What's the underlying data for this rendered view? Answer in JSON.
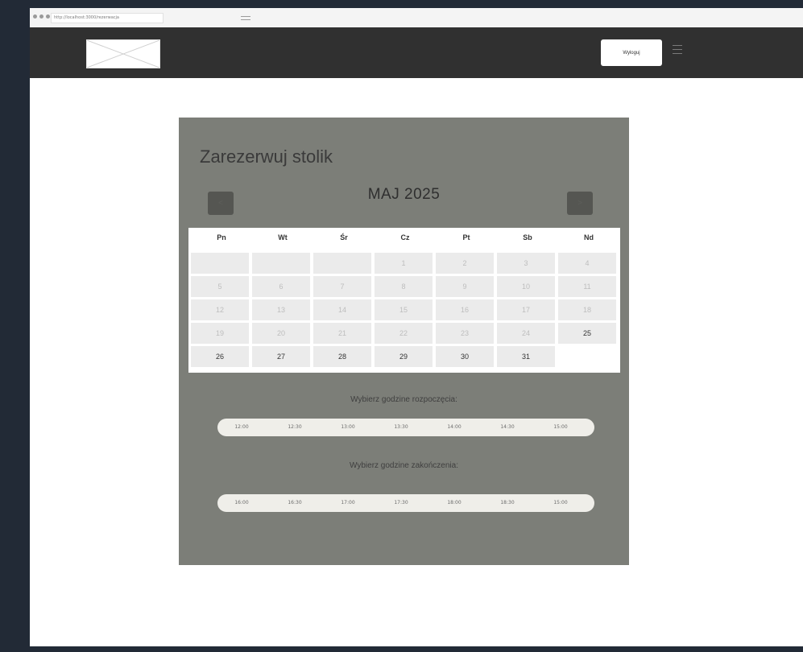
{
  "browser": {
    "url": "http://localhost:3000/rezerwacja"
  },
  "header": {
    "logout_label": "Wyloguj"
  },
  "reservation": {
    "title": "Zarezerwuj stolik",
    "month": "MAJ 2025",
    "prev_icon": "<",
    "next_icon": ">",
    "weekdays": [
      "Pn",
      "Wt",
      "Śr",
      "Cz",
      "Pt",
      "Sb",
      "Nd"
    ],
    "days": [
      {
        "label": "",
        "state": "empty"
      },
      {
        "label": "",
        "state": "empty"
      },
      {
        "label": "",
        "state": "empty"
      },
      {
        "label": "1",
        "state": "disabled"
      },
      {
        "label": "2",
        "state": "disabled"
      },
      {
        "label": "3",
        "state": "disabled"
      },
      {
        "label": "4",
        "state": "disabled"
      },
      {
        "label": "5",
        "state": "disabled"
      },
      {
        "label": "6",
        "state": "disabled"
      },
      {
        "label": "7",
        "state": "disabled"
      },
      {
        "label": "8",
        "state": "disabled"
      },
      {
        "label": "9",
        "state": "disabled"
      },
      {
        "label": "10",
        "state": "disabled"
      },
      {
        "label": "11",
        "state": "disabled"
      },
      {
        "label": "12",
        "state": "disabled"
      },
      {
        "label": "13",
        "state": "disabled"
      },
      {
        "label": "14",
        "state": "disabled"
      },
      {
        "label": "15",
        "state": "disabled"
      },
      {
        "label": "16",
        "state": "disabled"
      },
      {
        "label": "17",
        "state": "disabled"
      },
      {
        "label": "18",
        "state": "disabled"
      },
      {
        "label": "19",
        "state": "disabled"
      },
      {
        "label": "20",
        "state": "disabled"
      },
      {
        "label": "21",
        "state": "disabled"
      },
      {
        "label": "22",
        "state": "disabled"
      },
      {
        "label": "23",
        "state": "disabled"
      },
      {
        "label": "24",
        "state": "disabled"
      },
      {
        "label": "25",
        "state": "active"
      },
      {
        "label": "26",
        "state": "active"
      },
      {
        "label": "27",
        "state": "active"
      },
      {
        "label": "28",
        "state": "active"
      },
      {
        "label": "29",
        "state": "active"
      },
      {
        "label": "30",
        "state": "active"
      },
      {
        "label": "31",
        "state": "active"
      },
      {
        "label": "",
        "state": "blank"
      }
    ],
    "start_label": "Wybierz godzine rozpoczęcia:",
    "start_times": [
      "12:00",
      "12:30",
      "13:00",
      "13:30",
      "14:00",
      "14:30",
      "15:00"
    ],
    "end_label": "Wybierz godzine zakończenia:",
    "end_times": [
      "16:00",
      "16:30",
      "17:00",
      "17:30",
      "18:00",
      "18:30",
      "15:00"
    ]
  },
  "colors": {
    "frame": "#222a36",
    "header_bg": "#303030",
    "panel_bg": "#7c7e78",
    "nav_button": "#555652",
    "day_cell": "#ebebeb",
    "time_pill": "#efeee9"
  }
}
